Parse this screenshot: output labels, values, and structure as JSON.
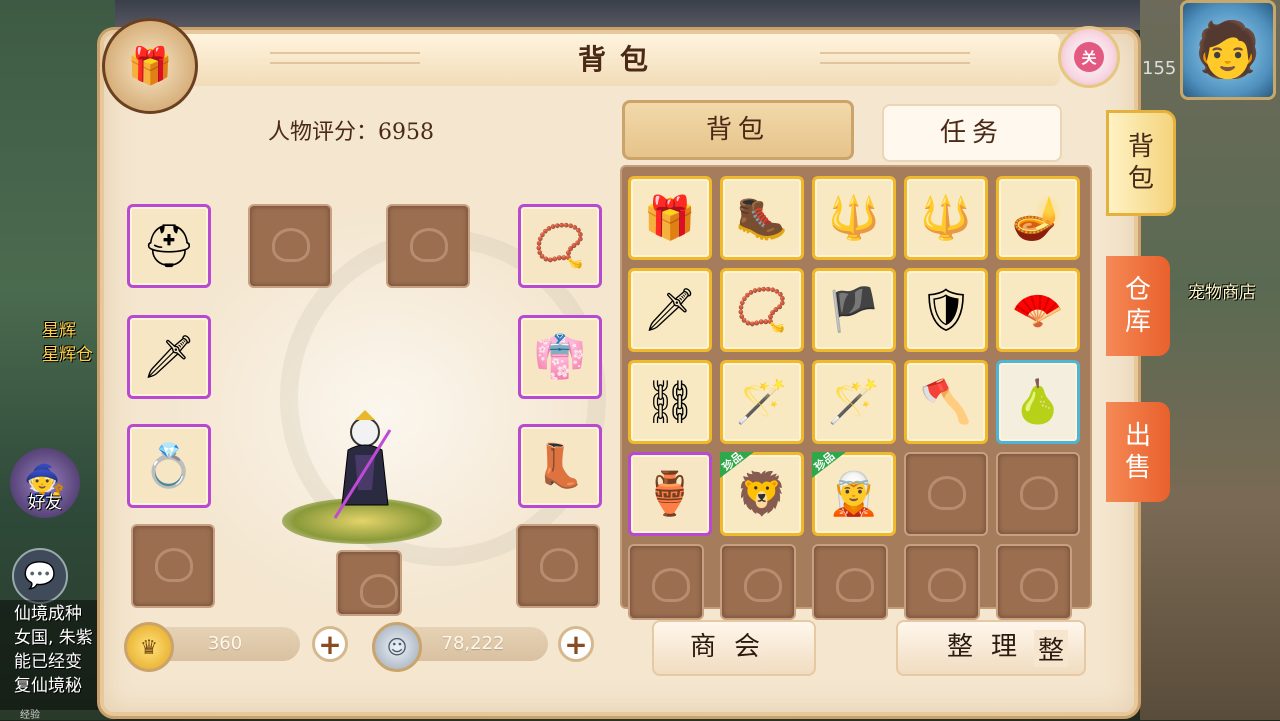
{
  "window": {
    "title": "背包",
    "close_label": "关"
  },
  "character": {
    "score_label": "人物评分：",
    "score_value": "6958"
  },
  "currency": {
    "gold": "360",
    "silver": "78,222"
  },
  "tabs": {
    "bag": "背包",
    "task": "任务"
  },
  "side_tabs": {
    "bag": "背包",
    "warehouse": "仓库",
    "sell": "出售"
  },
  "buttons": {
    "guild": "商会",
    "sort": "整理",
    "sort_overlay": "整"
  },
  "background": {
    "level_text": "155",
    "pet_shop": "宠物商店",
    "friends": "好友",
    "star_text_1": "星辉",
    "star_text_2": "星辉仓",
    "chat_lines": [
      "仙境成种",
      "女国, 朱紫",
      "能已经变",
      "复仙境秘"
    ],
    "exp_label": "经验"
  },
  "badges": {
    "rare": "珍品"
  },
  "equipment_left": [
    {
      "name": "helmet-item",
      "icon": "⛑",
      "rarity": "purple"
    },
    {
      "name": "empty",
      "rarity": "empty"
    },
    {
      "name": "empty",
      "rarity": "empty"
    },
    {
      "name": "necklace-item",
      "icon": "📿",
      "rarity": "purple"
    },
    {
      "name": "spear-item",
      "icon": "🗡",
      "rarity": "purple"
    },
    {
      "name": "robe-item",
      "icon": "👘",
      "rarity": "purple"
    },
    {
      "name": "belt-item",
      "icon": "💍",
      "rarity": "purple"
    },
    {
      "name": "boots-item",
      "icon": "👢",
      "rarity": "purple"
    },
    {
      "name": "empty",
      "rarity": "empty"
    },
    {
      "name": "empty",
      "rarity": "empty"
    },
    {
      "name": "empty",
      "rarity": "empty"
    }
  ],
  "inventory": [
    {
      "name": "treasure-chest-item",
      "icon": "🎁",
      "rarity": "gold"
    },
    {
      "name": "boots-item",
      "icon": "🥾",
      "rarity": "gold"
    },
    {
      "name": "trident-item",
      "icon": "🔱",
      "rarity": "gold"
    },
    {
      "name": "trident-item",
      "icon": "🔱",
      "rarity": "gold"
    },
    {
      "name": "lamp-item",
      "icon": "🪔",
      "rarity": "gold"
    },
    {
      "name": "sword-item",
      "icon": "🗡",
      "rarity": "gold"
    },
    {
      "name": "bracelet-item",
      "icon": "📿",
      "rarity": "gold"
    },
    {
      "name": "banner-item",
      "icon": "🏴",
      "rarity": "gold"
    },
    {
      "name": "armor-item",
      "icon": "🛡",
      "rarity": "gold"
    },
    {
      "name": "fan-item",
      "icon": "🪭",
      "rarity": "gold"
    },
    {
      "name": "chain-item",
      "icon": "⛓",
      "rarity": "gold"
    },
    {
      "name": "staff-item",
      "icon": "🪄",
      "rarity": "gold"
    },
    {
      "name": "staff-item",
      "icon": "🪄",
      "rarity": "gold"
    },
    {
      "name": "axe-item",
      "icon": "🪓",
      "rarity": "gold"
    },
    {
      "name": "potion-item",
      "icon": "🍐",
      "rarity": "blue"
    },
    {
      "name": "vase-item",
      "icon": "🏺",
      "rarity": "purple"
    },
    {
      "name": "lion-card-item",
      "icon": "🦁",
      "rarity": "gold",
      "badge": true
    },
    {
      "name": "hero-card-item",
      "icon": "🧝",
      "rarity": "gold",
      "badge": true
    },
    {
      "name": "empty",
      "rarity": "empty"
    },
    {
      "name": "empty",
      "rarity": "empty"
    },
    {
      "name": "empty",
      "rarity": "empty"
    },
    {
      "name": "empty",
      "rarity": "empty"
    },
    {
      "name": "empty",
      "rarity": "empty"
    },
    {
      "name": "empty",
      "rarity": "empty"
    },
    {
      "name": "empty",
      "rarity": "empty"
    }
  ],
  "colors": {
    "panel": "#f4e6cf",
    "purple_border": "#b74ad0",
    "gold_border": "#f1b92a",
    "blue_border": "#4fb5d6",
    "side_active": "#f4d47c",
    "side_inactive": "#e9602c"
  }
}
